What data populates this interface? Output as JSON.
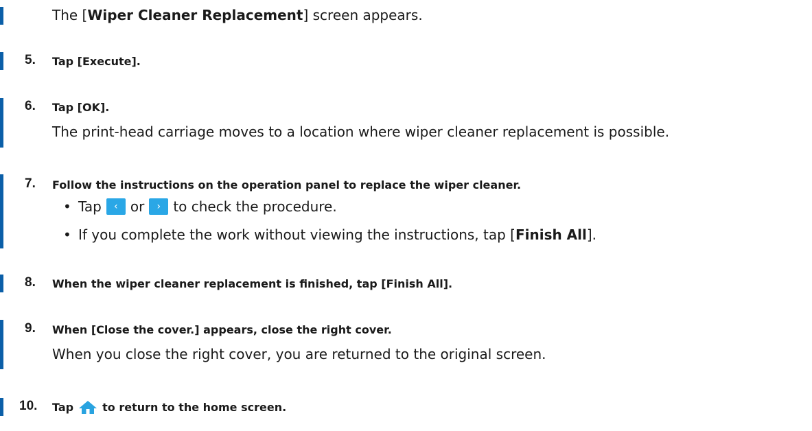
{
  "intro": {
    "prefix": "The [",
    "keyword": "Wiper Cleaner Replacement",
    "suffix": "] screen appears."
  },
  "steps": [
    {
      "number": "5.",
      "title": "Tap [Execute]."
    },
    {
      "number": "6.",
      "title": "Tap [OK].",
      "body": "The print-head carriage moves to a location where wiper cleaner replacement is possible."
    },
    {
      "number": "7.",
      "title": "Follow the instructions on the operation panel to replace the wiper cleaner.",
      "bullets": [
        {
          "prefix": "Tap",
          "middle": "or",
          "suffix": "to check the procedure.",
          "icons": [
            "chevron-left-icon",
            "chevron-right-icon"
          ]
        },
        {
          "prefix": "If you complete the work without viewing the instructions, tap [",
          "keyword": "Finish All",
          "suffix": "]."
        }
      ]
    },
    {
      "number": "8.",
      "title": "When the wiper cleaner replacement is finished, tap [Finish All]."
    },
    {
      "number": "9.",
      "title": "When [Close the cover.] appears, close the right cover.",
      "body": "When you close the right cover, you are returned to the original screen."
    },
    {
      "number": "10.",
      "title_prefix": "Tap",
      "title_suffix": "to return to the home screen.",
      "icon": "home-icon"
    }
  ],
  "colors": {
    "accent_bar": "#0b5fa8",
    "nav_button": "#2aa7e6",
    "home_icon": "#29a3e0"
  }
}
